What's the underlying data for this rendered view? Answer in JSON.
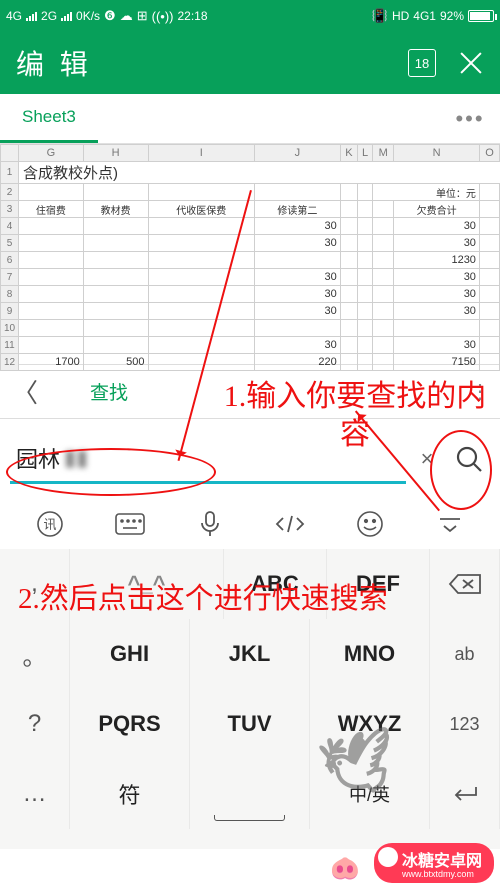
{
  "statusbar": {
    "net1": "4G",
    "net2": "2G",
    "speed": "0K/s",
    "time": "22:18",
    "hd": "HD",
    "net3": "4G1",
    "battery_pct": "92%"
  },
  "appbar": {
    "title": "编 辑",
    "badge": "18"
  },
  "tabs": {
    "active": "Sheet3",
    "more": "•••"
  },
  "sheet": {
    "columns": [
      "G",
      "H",
      "I",
      "J",
      "K",
      "L",
      "M",
      "N",
      "O"
    ],
    "title_row": "含成教校外点)",
    "unit_label": "单位：元",
    "headers": [
      "住宿费",
      "教材费",
      "代收医保费",
      "修读第二",
      "欠费合计"
    ],
    "rows": [
      {
        "n": "4",
        "j": "30",
        "n2": "30"
      },
      {
        "n": "5",
        "j": "30",
        "n2": "30"
      },
      {
        "n": "6",
        "j": "",
        "n2": "1230"
      },
      {
        "n": "7",
        "j": "30",
        "n2": "30"
      },
      {
        "n": "8",
        "j": "30",
        "n2": "30"
      },
      {
        "n": "9",
        "j": "30",
        "n2": "30"
      },
      {
        "n": "10",
        "j": "",
        "n2": ""
      },
      {
        "n": "11",
        "j": "30",
        "n2": "30"
      },
      {
        "n": "12",
        "g": "1700",
        "h": "500",
        "j": "220",
        "n2": "7150"
      }
    ]
  },
  "find": {
    "back": "〈",
    "label": "查找",
    "menu": "⋮"
  },
  "search": {
    "value": "园林",
    "blurred": "▮▮",
    "clear": "×"
  },
  "keypad": {
    "r1": [
      ",",
      "ABC",
      "DEF",
      "⌫"
    ],
    "r2": [
      "。",
      "GHI",
      "JKL",
      "MNO",
      "ab"
    ],
    "r3": [
      "?",
      "PQRS",
      "TUV",
      "WXYZ",
      "123"
    ],
    "r4": [
      "…",
      "符",
      "—",
      "中/英",
      "▭"
    ]
  },
  "annotations": {
    "a1": "1.输入你要查找的内容",
    "a2": "2.然后点击这个进行快速搜索"
  },
  "watermark": "冰糖安卓网",
  "watermark_sub": "www.btxtdmy.com"
}
